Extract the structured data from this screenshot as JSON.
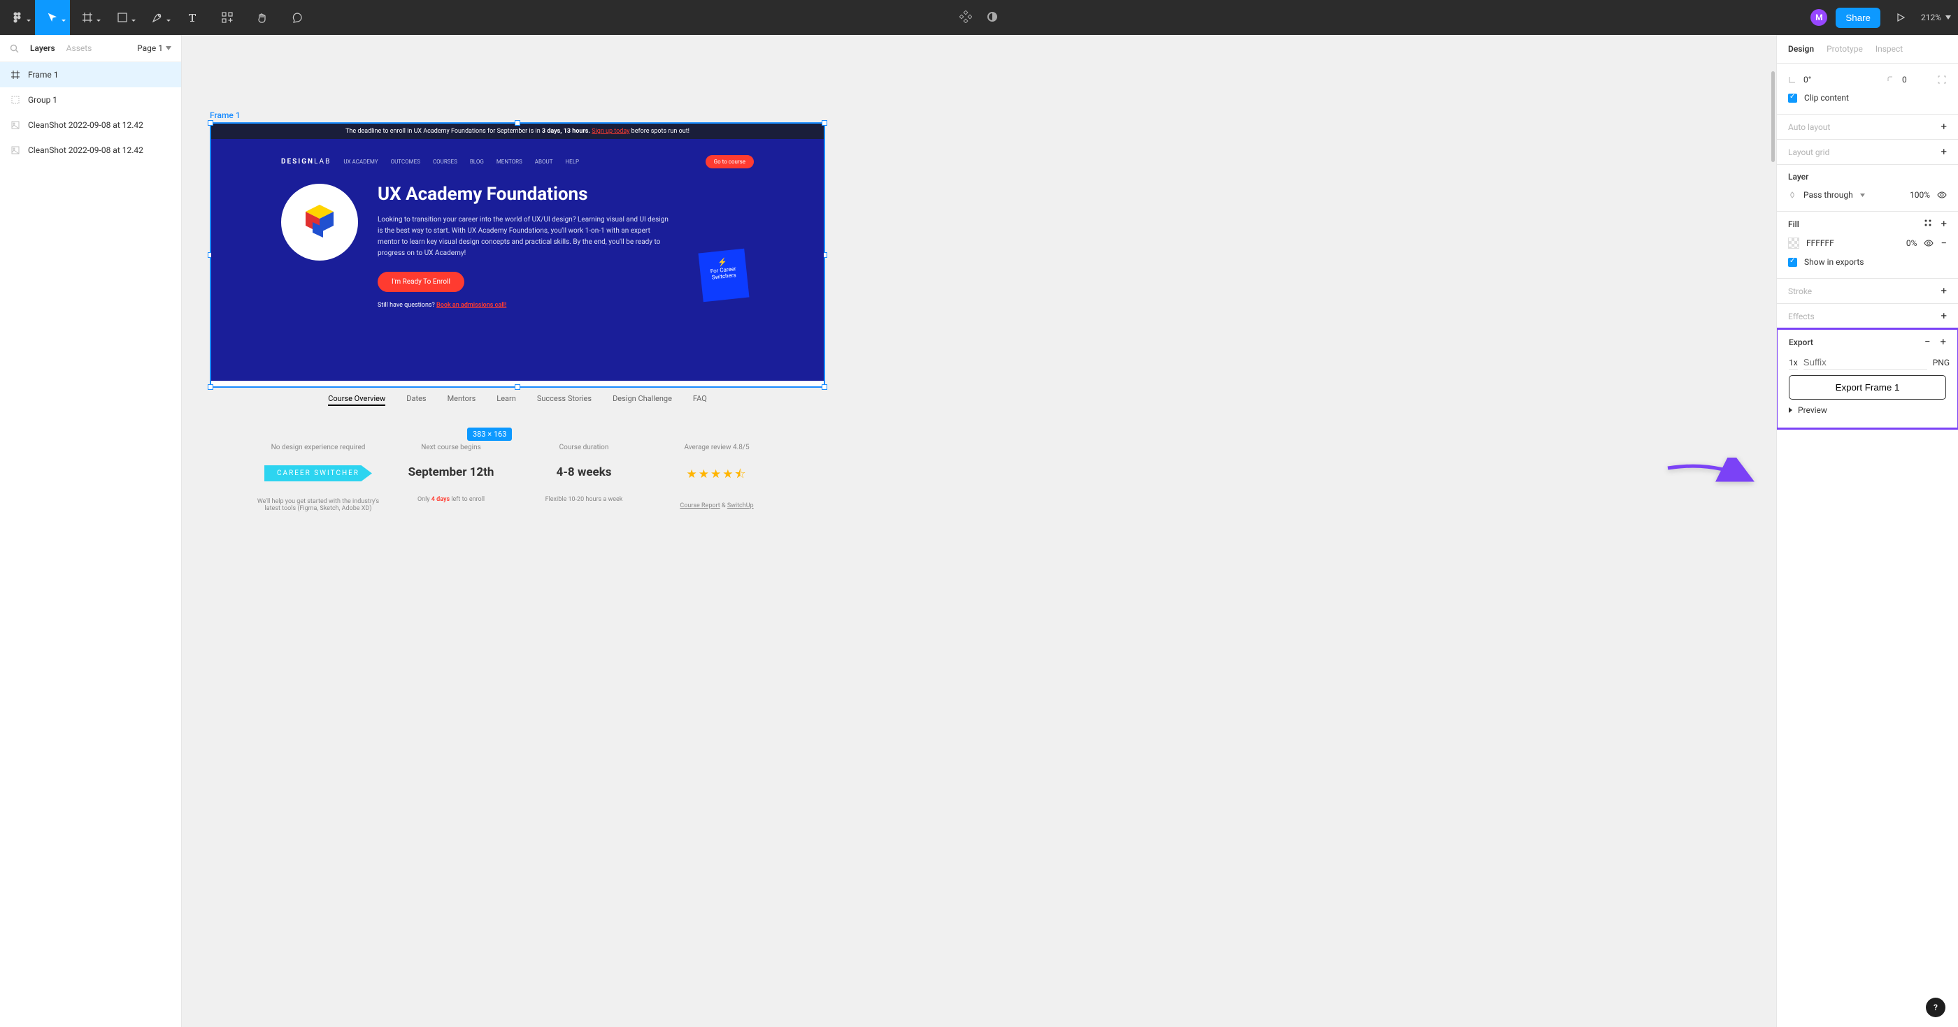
{
  "toolbar": {
    "avatar_initial": "M",
    "share": "Share",
    "zoom": "212%"
  },
  "left_panel": {
    "search_placeholder": "Search",
    "tabs": {
      "layers": "Layers",
      "assets": "Assets"
    },
    "page": "Page 1",
    "layers": [
      {
        "name": "Frame 1",
        "selected": true,
        "type": "frame"
      },
      {
        "name": "Group 1",
        "selected": false,
        "type": "group"
      },
      {
        "name": "CleanShot 2022-09-08 at 12.42",
        "selected": false,
        "type": "image"
      },
      {
        "name": "CleanShot 2022-09-08 at 12.42",
        "selected": false,
        "type": "image"
      }
    ]
  },
  "right_panel": {
    "tabs": {
      "design": "Design",
      "prototype": "Prototype",
      "inspect": "Inspect"
    },
    "rotation": "0°",
    "corner": "0",
    "clip": "Clip content",
    "auto_layout": "Auto layout",
    "layout_grid": "Layout grid",
    "layer": "Layer",
    "blend": "Pass through",
    "opacity": "100%",
    "fill": "Fill",
    "fill_hex": "FFFFFF",
    "fill_opacity": "0%",
    "show_export": "Show in exports",
    "stroke": "Stroke",
    "effects": "Effects",
    "export": "Export",
    "scale": "1x",
    "suffix_placeholder": "Suffix",
    "format": "PNG",
    "export_btn": "Export Frame 1",
    "preview": "Preview"
  },
  "canvas": {
    "frame_label": "Frame 1",
    "dimensions": "383 × 163",
    "banner": {
      "pre": "The deadline to enroll in UX Academy Foundations for September is in ",
      "time": "3 days, 13 hours.",
      "sign": "Sign up today",
      "post": " before spots run out!"
    },
    "nav": {
      "logo_a": "DESIGN",
      "logo_b": "LAB",
      "links": [
        "UX ACADEMY",
        "OUTCOMES",
        "COURSES",
        "BLOG",
        "MENTORS",
        "ABOUT",
        "HELP"
      ],
      "cta": "Go to course"
    },
    "hero": {
      "title": "UX Academy Foundations",
      "text": "Looking to transition your career into the world of UX/UI design? Learning visual and UI design is the best way to start. With UX Academy Foundations, you'll work 1-on-1 with an expert mentor to learn key visual design concepts and practical skills. By the end, you'll be ready to progress on to UX Academy!",
      "enroll": "I'm Ready To Enroll",
      "q1": "Still have questions? ",
      "q2": "Book an admissions call!",
      "badge_line1": "For Career",
      "badge_line2": "Switchers"
    },
    "tabs": [
      "Course Overview",
      "Dates",
      "Mentors",
      "Learn",
      "Success Stories",
      "Design Challenge",
      "FAQ"
    ],
    "info": {
      "c1_head": "No design experience required",
      "c1_pill": "CAREER SWITCHER",
      "c1_sub": "We'll help you get started with the industry's latest tools (Figma, Sketch, Adobe XD)",
      "c2_head": "Next course begins",
      "c2_big": "September 12th",
      "c2_sub_a": "Only ",
      "c2_sub_b": "4 days",
      "c2_sub_c": " left to enroll",
      "c3_head": "Course duration",
      "c3_big": "4-8 weeks",
      "c3_sub": "Flexible 10-20 hours a week",
      "c4_head": "Average review 4.8/5",
      "c4_sub_a": "Course Report",
      "c4_sub_b": " & ",
      "c4_sub_c": "SwitchUp"
    }
  },
  "help": "?"
}
